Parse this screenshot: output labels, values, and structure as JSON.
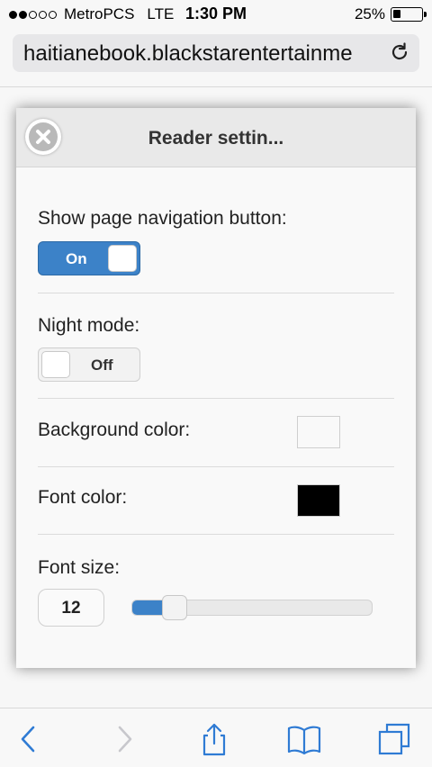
{
  "status_bar": {
    "carrier": "MetroPCS",
    "network": "LTE",
    "time": "1:30 PM",
    "battery_percent": "25%",
    "battery_level": 0.25,
    "signal_bars_filled": 2,
    "signal_bars_total": 5
  },
  "browser": {
    "url": "haitianebook.blackstarentertainme",
    "icons": {
      "reload": "reload-icon",
      "back": "back-icon",
      "forward": "forward-icon",
      "share": "share-icon",
      "bookmarks": "bookmarks-icon",
      "tabs": "tabs-icon"
    }
  },
  "dialog": {
    "title": "Reader settin...",
    "close_icon": "close-icon",
    "page_nav": {
      "label": "Show page navigation button:",
      "state": "On"
    },
    "night_mode": {
      "label": "Night mode:",
      "state": "Off"
    },
    "background_color": {
      "label": "Background color:",
      "value": "#f9f9f9"
    },
    "font_color": {
      "label": "Font color:",
      "value": "#000000"
    },
    "font_size": {
      "label": "Font size:",
      "value": "12",
      "slider_fraction": 0.14
    }
  },
  "colors": {
    "accent": "#3c82c8"
  }
}
